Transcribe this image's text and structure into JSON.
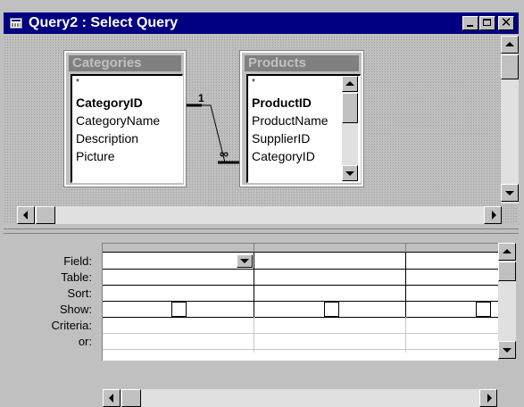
{
  "window": {
    "title": "Query2 : Select Query"
  },
  "tables": [
    {
      "name": "Categories",
      "star": "*",
      "fields": [
        "CategoryID",
        "CategoryName",
        "Description",
        "Picture"
      ],
      "key": "CategoryID"
    },
    {
      "name": "Products",
      "star": "*",
      "fields": [
        "ProductID",
        "ProductName",
        "SupplierID",
        "CategoryID"
      ],
      "key": "ProductID"
    }
  ],
  "relationship": {
    "one_label": "1",
    "many_label": "∞"
  },
  "grid": {
    "row_labels": [
      "Field:",
      "Table:",
      "Sort:",
      "Show:",
      "Criteria:",
      "or:"
    ],
    "show_checked": [
      false,
      false,
      false
    ]
  }
}
